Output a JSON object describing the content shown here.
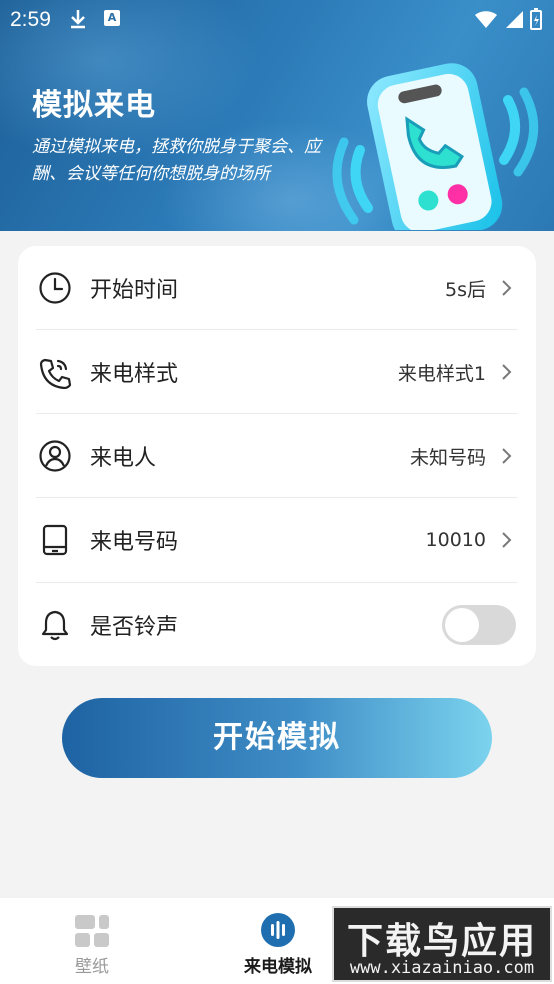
{
  "status_bar": {
    "time": "2:59"
  },
  "hero": {
    "title": "模拟来电",
    "description": "通过模拟来电，拯救你脱身于聚会、应酬、会议等任何你想脱身的场所"
  },
  "settings": [
    {
      "label": "开始时间",
      "value": "5s后",
      "icon": "clock-icon"
    },
    {
      "label": "来电样式",
      "value": "来电样式1",
      "icon": "phone-call-icon"
    },
    {
      "label": "来电人",
      "value": "未知号码",
      "icon": "person-icon"
    },
    {
      "label": "来电号码",
      "value": "10010",
      "icon": "tablet-icon"
    },
    {
      "label": "是否铃声",
      "toggle_on": false,
      "icon": "bell-icon"
    }
  ],
  "start_button": {
    "label": "开始模拟"
  },
  "tabs": [
    {
      "label": "壁纸",
      "icon": "wallpaper-icon",
      "active": false
    },
    {
      "label": "来电模拟",
      "icon": "voice-bars-icon",
      "active": true
    }
  ],
  "watermark": {
    "line1": "下载鸟应用",
    "line2": "www.xiazainiao.com"
  },
  "colors": {
    "accent_start": "#1e63a3",
    "accent_end": "#7bd3ee",
    "toggle_off": "#d9d9d9"
  }
}
